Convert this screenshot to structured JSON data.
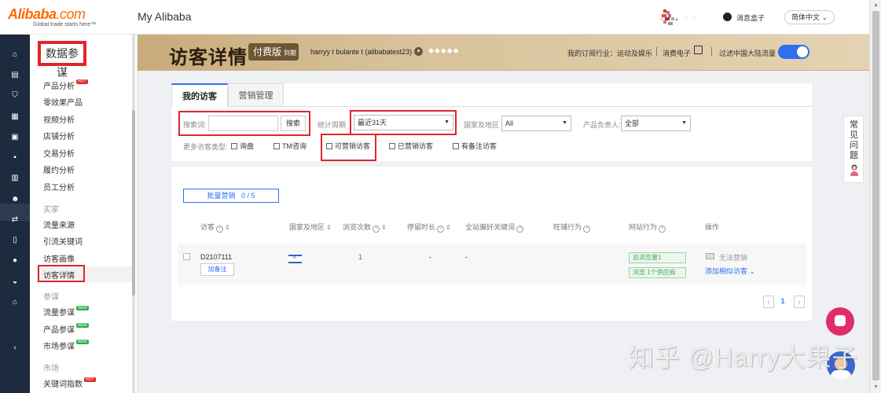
{
  "header": {
    "logo_brand": "Alibaba",
    "logo_suffix": ".com",
    "logo_tagline": "Global trade starts here™",
    "app_title": "My Alibaba",
    "message_box": "消息盒子",
    "language": "简体中文"
  },
  "left_nav": {
    "title": "数据参谋",
    "items": [
      {
        "label": "产品分析",
        "badge": "HOT"
      },
      {
        "label": "零效果产品"
      },
      {
        "label": "视频分析"
      },
      {
        "label": "店铺分析"
      },
      {
        "label": "交易分析"
      },
      {
        "label": "履约分析"
      },
      {
        "label": "员工分析"
      }
    ],
    "group_buyer": "买家",
    "buyer_items": [
      {
        "label": "流量来源"
      },
      {
        "label": "引流关键词"
      },
      {
        "label": "访客画像"
      },
      {
        "label": "访客详情",
        "active": true
      }
    ],
    "group_advisor": "参谋",
    "advisor_items": [
      {
        "label": "流量参谋",
        "badge": "NEW"
      },
      {
        "label": "产品参谋",
        "badge": "NEW"
      },
      {
        "label": "市场参谋",
        "badge": "NEW"
      }
    ],
    "group_market": "市场",
    "market_items": [
      {
        "label": "关键词指数",
        "badge": "HOT"
      }
    ]
  },
  "banner": {
    "title": "访客详情",
    "plan": "付费版",
    "plan_status": "到期",
    "user": "harryy t bulante t (alibabatest23)",
    "industry": "我的订阅行业：运动及娱乐",
    "consumer_electronics": "消费电子",
    "filter_label": "过滤中国大陆流量",
    "filter_on": true
  },
  "tabs": [
    {
      "label": "我的访客",
      "active": true
    },
    {
      "label": "营销管理",
      "active": false
    }
  ],
  "filters": {
    "search_label": "搜索词:",
    "search_value": "",
    "search_button": "搜索",
    "period_label": "统计周期",
    "period_value": "最近31天",
    "region_label": "国家及地区",
    "region_value": "All",
    "owner_label": "产品负责人:",
    "owner_value": "全部",
    "more_types_label": "更多访客类型:",
    "checkboxes": [
      {
        "label": "询盘",
        "checked": false
      },
      {
        "label": "TM咨询",
        "checked": false
      },
      {
        "label": "可营销访客",
        "checked": false
      },
      {
        "label": "已营销访客",
        "checked": false
      },
      {
        "label": "有备注访客",
        "checked": false
      }
    ]
  },
  "batch": {
    "label": "批量营销",
    "count": "0 / 5"
  },
  "table": {
    "columns": [
      "访客",
      "国家及地区",
      "浏览次数",
      "停留时长",
      "全站偏好关键词",
      "旺铺行为",
      "网站行为",
      "操作"
    ],
    "rows": [
      {
        "visitor": "D2107111",
        "note_button": "加备注",
        "views": "1",
        "duration": "-",
        "keywords": "-",
        "site_tag_1": "总浏览量1",
        "site_tag_2": "浏览 1个供应商",
        "action_status": "无法营销",
        "action_link": "添加相似访客"
      }
    ]
  },
  "pagination": {
    "prev": "‹",
    "current": "1",
    "next": "›"
  },
  "faq": "常见问题",
  "watermark": "知乎 @Harry大果子"
}
